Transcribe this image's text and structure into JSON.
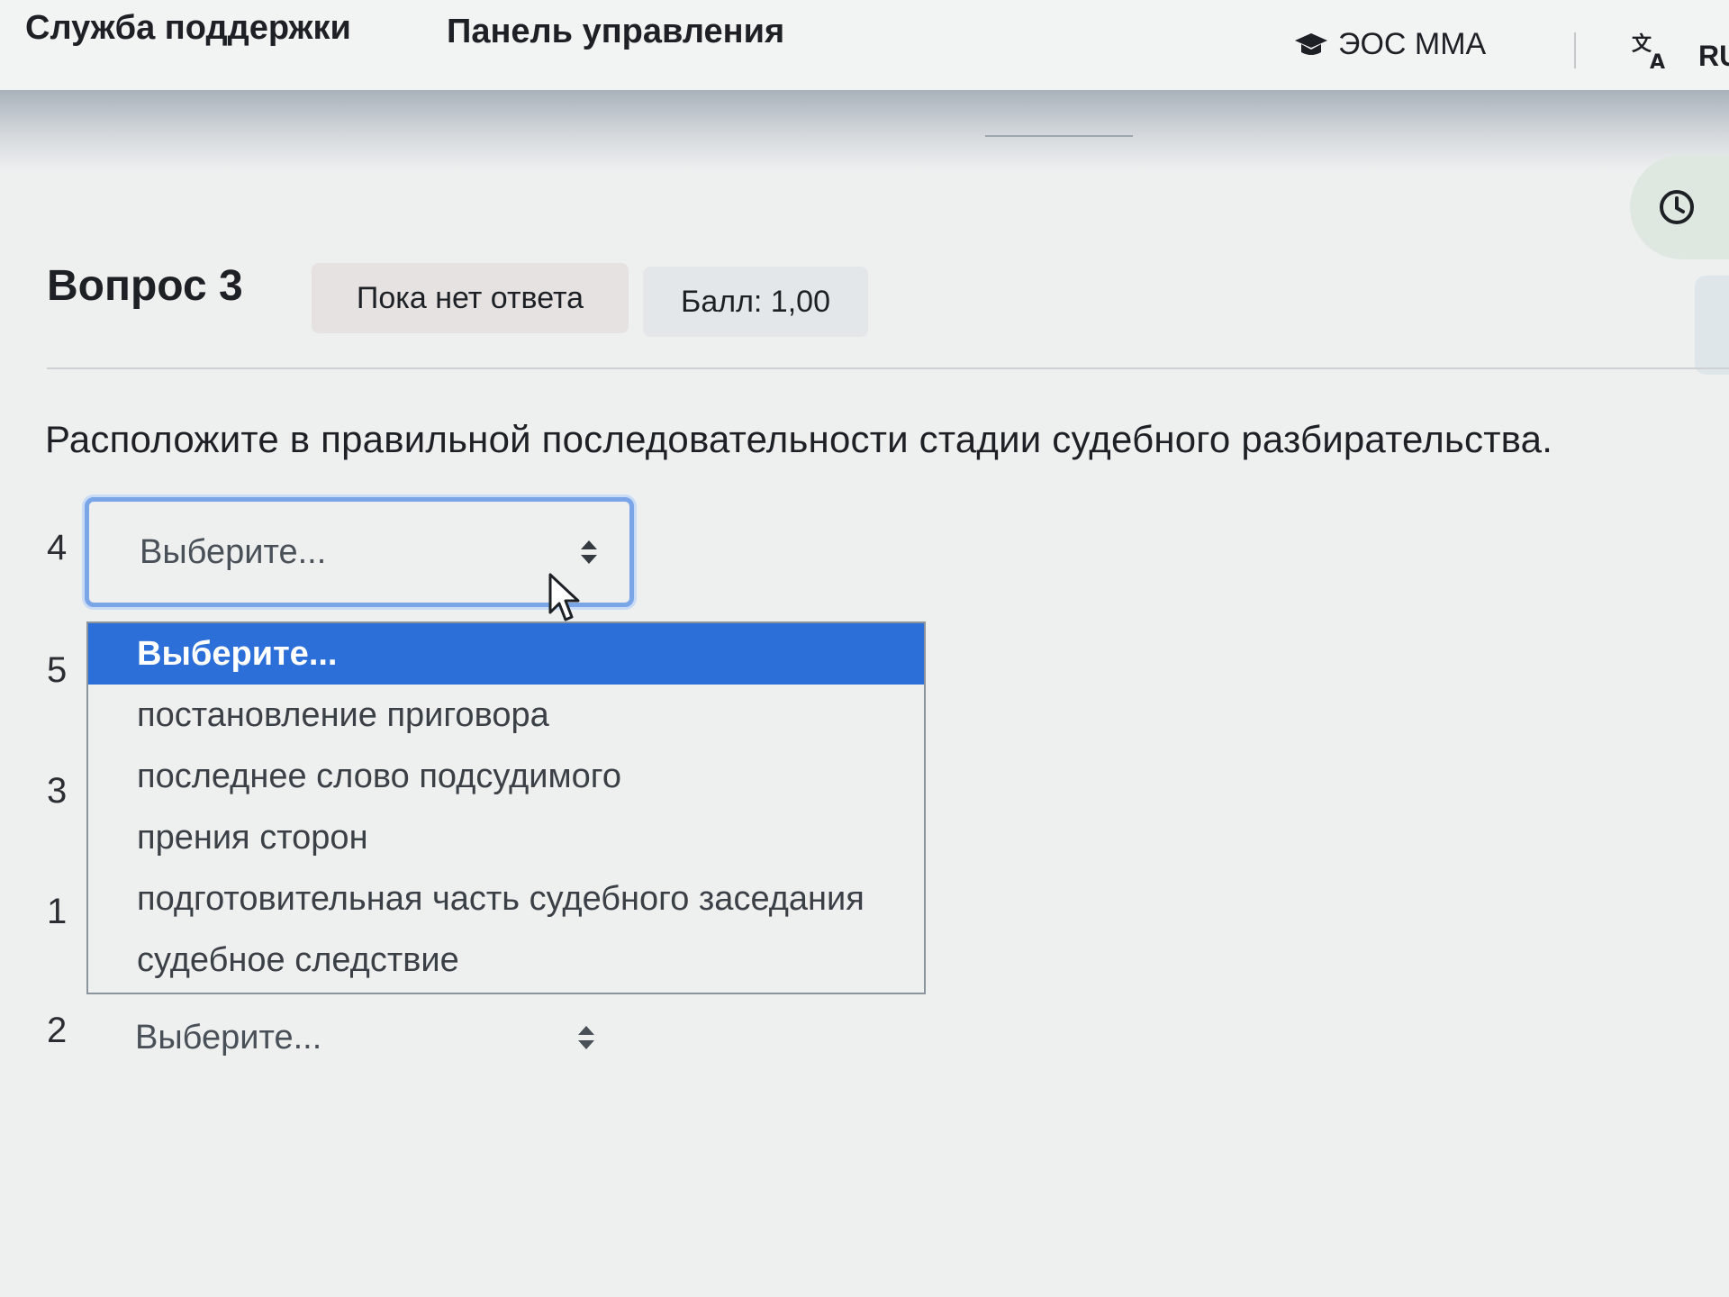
{
  "nav": {
    "support": "Служба поддержки",
    "dashboard": "Панель управления",
    "site_name": "ЭОС ММА",
    "site_icon": "graduation-cap-icon",
    "lang_icon": "translate-icon",
    "lang_code": "RU"
  },
  "timer": {
    "icon": "clock-icon"
  },
  "question": {
    "title": "Вопрос 3",
    "status": "Пока нет ответа",
    "score": "Балл: 1,00",
    "text": "Расположите в правильной последовательности стадии судебного разбирательства."
  },
  "rows": [
    {
      "number": "4",
      "value": "Выберите..."
    },
    {
      "number": "5",
      "value": ""
    },
    {
      "number": "3",
      "value": ""
    },
    {
      "number": "1",
      "value": ""
    },
    {
      "number": "2",
      "value": "Выберите..."
    }
  ],
  "dropdown": {
    "options": [
      "Выберите...",
      "постановление приговора",
      "последнее слово подсудимого",
      "прения сторон",
      "подготовительная часть судебного заседания",
      "судебное следствие"
    ],
    "selected_index": 0
  },
  "colors": {
    "accent": "#2d6fd8",
    "focus_border": "#7aa6e8"
  }
}
